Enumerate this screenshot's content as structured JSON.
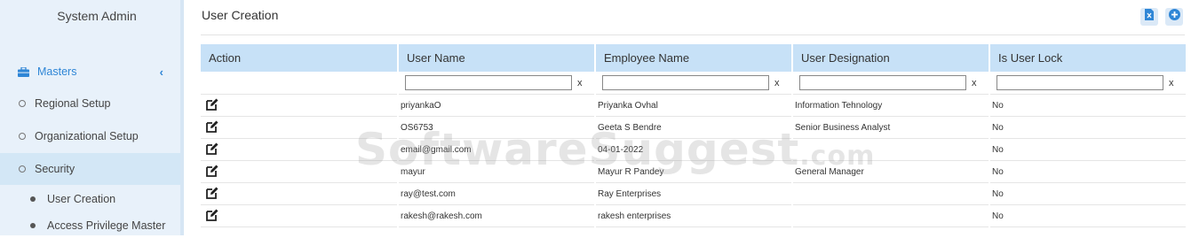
{
  "sidebar": {
    "title": "System Admin",
    "masters_label": "Masters",
    "items": [
      {
        "label": "Regional Setup"
      },
      {
        "label": "Organizational Setup"
      },
      {
        "label": "Security"
      }
    ],
    "subitems": [
      {
        "label": "User Creation"
      },
      {
        "label": "Access Privilege Master"
      }
    ]
  },
  "header": {
    "title": "User Creation",
    "export_icon": "excel-export-icon",
    "add_icon": "plus-circle-icon"
  },
  "table": {
    "columns": [
      "Action",
      "User Name",
      "Employee Name",
      "User Designation",
      "Is User Lock"
    ],
    "filter_clear": "x",
    "rows": [
      {
        "user_name": "priyankaO",
        "employee_name": "Priyanka Ovhal",
        "designation": "Information Tehnology",
        "lock": "No"
      },
      {
        "user_name": "OS6753",
        "employee_name": "Geeta S Bendre",
        "designation": "Senior Business Analyst",
        "lock": "No"
      },
      {
        "user_name": "email@gmail.com",
        "employee_name": "04-01-2022",
        "designation": "",
        "lock": "No"
      },
      {
        "user_name": "mayur",
        "employee_name": "Mayur R Pandey",
        "designation": "General Manager",
        "lock": "No"
      },
      {
        "user_name": "ray@test.com",
        "employee_name": "Ray Enterprises",
        "designation": "",
        "lock": "No"
      },
      {
        "user_name": "rakesh@rakesh.com",
        "employee_name": "rakesh enterprises",
        "designation": "",
        "lock": "No"
      }
    ]
  },
  "watermark": {
    "main": "SoftwareSuggest",
    "suffix": ".com"
  },
  "colors": {
    "accent": "#2f86d6",
    "sidebar_bg": "#e8f1fa",
    "active_item_bg": "#d3e7f6",
    "header_bg": "#c7e1f7"
  }
}
